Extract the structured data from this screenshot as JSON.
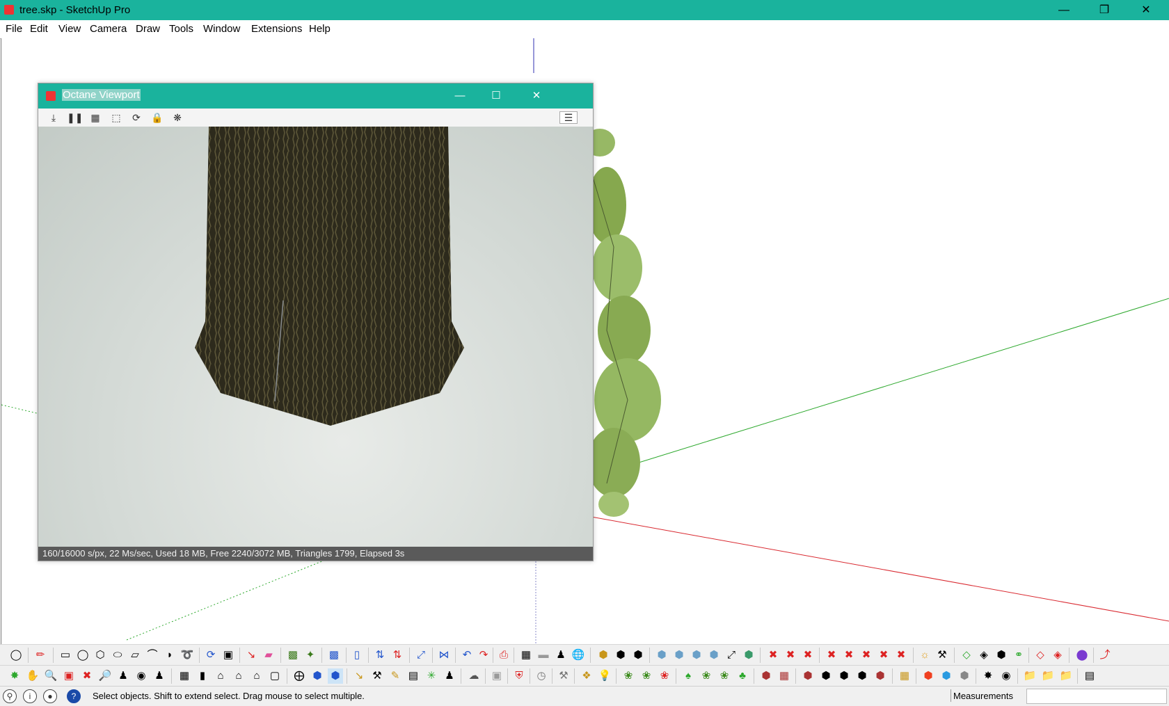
{
  "window": {
    "title": "tree.skp - SketchUp Pro"
  },
  "menu": [
    "File",
    "Edit",
    "View",
    "Camera",
    "Draw",
    "Tools",
    "Window",
    "Extensions",
    "Help"
  ],
  "octane": {
    "title": "Octane Viewport",
    "status": "160/16000 s/px, 22 Ms/sec, Used 18 MB, Free 2240/3072 MB, Triangles 1799, Elapsed 3s"
  },
  "statusbar": {
    "message": "Select objects. Shift to extend select. Drag mouse to select multiple.",
    "measurements_label": "Measurements",
    "measurements_value": ""
  },
  "colors": {
    "titlebar": "#1ab39d",
    "axis_red": "#d9282f",
    "axis_green": "#2ca82c",
    "axis_blue": "#2f2fb0"
  }
}
